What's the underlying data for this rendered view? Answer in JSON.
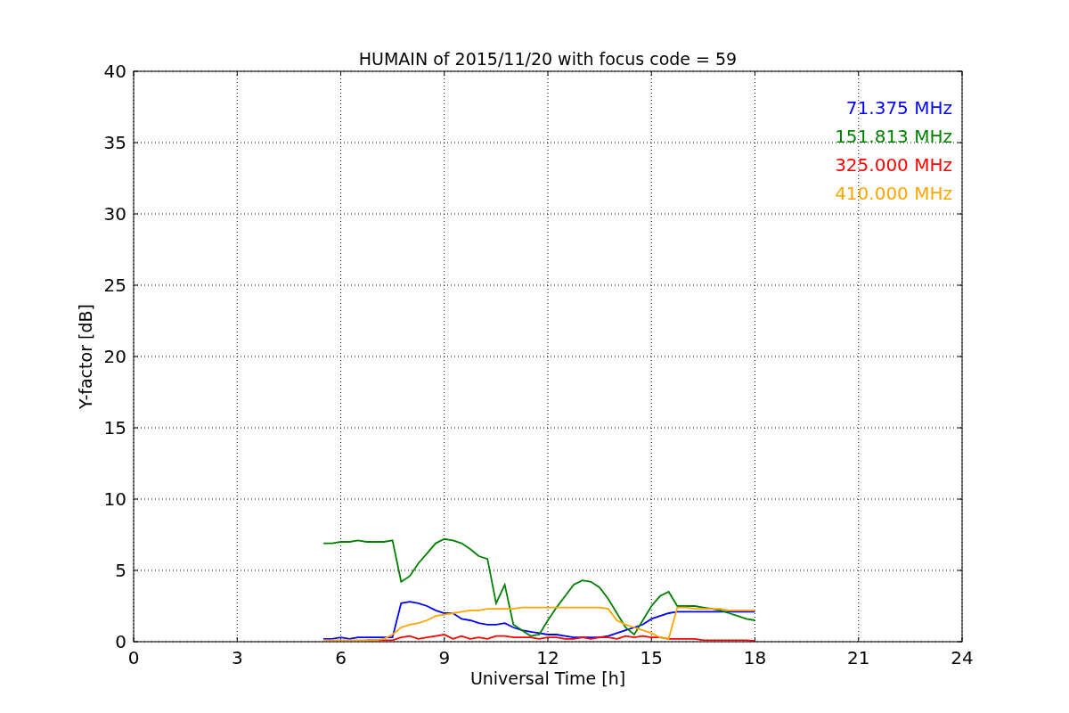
{
  "figure": {
    "chart_data": {
      "type": "line",
      "title": "HUMAIN of 2015/11/20 with focus code = 59",
      "xlabel": "Universal Time [h]",
      "ylabel": "Y-factor [dB]",
      "x": [
        5.5,
        5.75,
        6,
        6.25,
        6.5,
        6.75,
        7,
        7.25,
        7.5,
        7.75,
        8,
        8.25,
        8.5,
        8.75,
        9,
        9.25,
        9.5,
        9.75,
        10,
        10.25,
        10.5,
        10.75,
        11,
        11.25,
        11.5,
        11.75,
        12,
        12.25,
        12.5,
        12.75,
        13,
        13.25,
        13.5,
        13.75,
        14,
        14.25,
        14.5,
        14.75,
        15,
        15.25,
        15.5,
        15.75,
        16,
        16.25,
        16.5,
        16.75,
        17,
        17.25,
        17.5,
        17.75,
        18
      ],
      "series": [
        {
          "name": "71.375 MHz",
          "color": "#0000ff",
          "values": [
            0.2,
            0.2,
            0.3,
            0.2,
            0.3,
            0.3,
            0.3,
            0.3,
            0.3,
            2.7,
            2.8,
            2.7,
            2.5,
            2.2,
            2.0,
            2.0,
            1.6,
            1.5,
            1.3,
            1.2,
            1.2,
            1.3,
            1.0,
            0.8,
            0.7,
            0.6,
            0.5,
            0.5,
            0.4,
            0.3,
            0.3,
            0.3,
            0.3,
            0.4,
            0.6,
            0.8,
            1.0,
            1.2,
            1.6,
            1.8,
            2.0,
            2.1,
            2.1,
            2.1,
            2.1,
            2.1,
            2.1,
            2.1,
            2.1,
            2.1,
            2.1
          ]
        },
        {
          "name": "151.813 MHz",
          "color": "#008000",
          "values": [
            6.9,
            6.9,
            7.0,
            7.0,
            7.1,
            7.0,
            7.0,
            7.0,
            7.1,
            4.2,
            4.6,
            5.5,
            6.2,
            6.9,
            7.2,
            7.1,
            6.9,
            6.5,
            6.0,
            5.8,
            2.7,
            4.0,
            1.2,
            0.8,
            0.4,
            0.5,
            1.5,
            2.4,
            3.2,
            4.0,
            4.3,
            4.2,
            3.8,
            3.0,
            2.0,
            1.0,
            0.5,
            1.5,
            2.5,
            3.2,
            3.5,
            2.5,
            2.5,
            2.5,
            2.4,
            2.3,
            2.2,
            2.0,
            1.8,
            1.6,
            1.5
          ]
        },
        {
          "name": "325.000 MHz",
          "color": "#ff0000",
          "values": [
            null,
            null,
            null,
            null,
            null,
            0.1,
            0.1,
            0.1,
            0.1,
            0.3,
            0.4,
            0.2,
            0.3,
            0.4,
            0.5,
            0.2,
            0.4,
            0.2,
            0.3,
            0.2,
            0.4,
            0.4,
            0.3,
            0.3,
            0.3,
            0.2,
            0.3,
            0.3,
            0.2,
            0.2,
            0.3,
            0.2,
            0.3,
            0.3,
            0.2,
            0.4,
            0.3,
            0.4,
            0.3,
            0.3,
            0.2,
            0.2,
            0.2,
            0.2,
            0.1,
            0.1,
            0.1,
            0.1,
            0.1,
            0.1,
            0.05
          ]
        },
        {
          "name": "410.000 MHz",
          "color": "#ffa500",
          "values": [
            0.1,
            0.1,
            0.1,
            0.1,
            0.1,
            0.1,
            0.1,
            0.2,
            0.5,
            1.0,
            1.2,
            1.3,
            1.5,
            1.8,
            1.9,
            2.0,
            2.1,
            2.2,
            2.2,
            2.3,
            2.3,
            2.3,
            2.3,
            2.4,
            2.4,
            2.4,
            2.4,
            2.4,
            2.4,
            2.4,
            2.4,
            2.4,
            2.4,
            2.3,
            1.5,
            1.2,
            1.0,
            0.8,
            0.6,
            0.3,
            0.2,
            2.4,
            2.4,
            2.3,
            2.3,
            2.3,
            2.3,
            2.2,
            2.2,
            2.2,
            2.2
          ]
        }
      ],
      "grid": true,
      "xlim": [
        0,
        24
      ],
      "ylim": [
        0,
        40
      ],
      "xticks": [
        0,
        3,
        6,
        9,
        12,
        15,
        18,
        21,
        24
      ],
      "yticks": [
        0,
        5,
        10,
        15,
        20,
        25,
        30,
        35,
        40
      ]
    }
  }
}
